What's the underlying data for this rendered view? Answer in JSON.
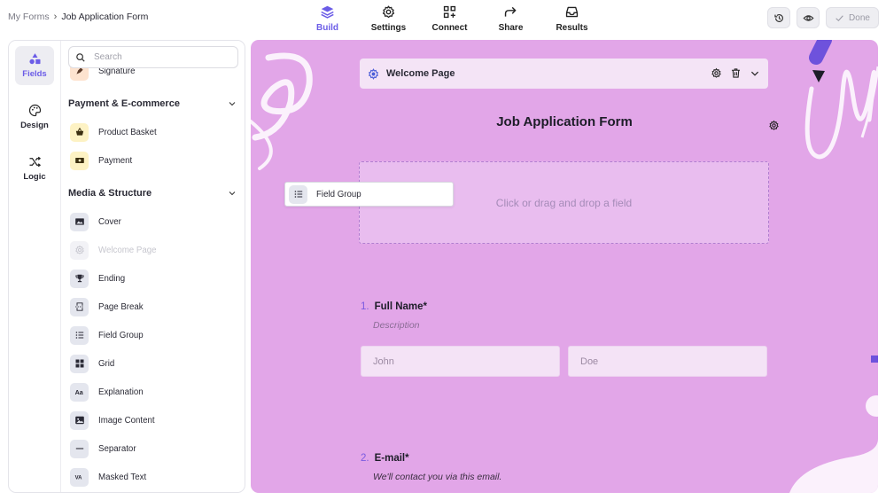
{
  "breadcrumb": {
    "root": "My Forms",
    "separator": "›",
    "current": "Job Application Form"
  },
  "nav": {
    "tabs": [
      {
        "label": "Build",
        "icon": "layers-icon",
        "active": true
      },
      {
        "label": "Settings",
        "icon": "gear-icon",
        "active": false
      },
      {
        "label": "Connect",
        "icon": "connect-grid-icon",
        "active": false
      },
      {
        "label": "Share",
        "icon": "share-arrow-icon",
        "active": false
      },
      {
        "label": "Results",
        "icon": "inbox-icon",
        "active": false
      }
    ]
  },
  "toolbar": {
    "done_label": "Done"
  },
  "rail": {
    "items": [
      {
        "label": "Fields",
        "icon": "shapes-icon",
        "active": true
      },
      {
        "label": "Design",
        "icon": "palette-icon",
        "active": false
      },
      {
        "label": "Logic",
        "icon": "shuffle-icon",
        "active": false
      }
    ]
  },
  "search": {
    "placeholder": "Search"
  },
  "fields": {
    "partial_item": "Signature",
    "sections": [
      {
        "title": "Payment & E-commerce",
        "items": [
          "Product Basket",
          "Payment"
        ]
      },
      {
        "title": "Media & Structure",
        "items": [
          "Cover",
          "Welcome Page",
          "Ending",
          "Page Break",
          "Field Group",
          "Grid",
          "Explanation",
          "Image Content",
          "Separator",
          "Masked Text"
        ]
      }
    ],
    "disabled": [
      "Welcome Page"
    ]
  },
  "canvas": {
    "welcome_bar_title": "Welcome Page",
    "form_title": "Job Application Form",
    "dropzone_text": "Click or drag and drop a field",
    "drag_ghost_label": "Field Group",
    "questions": [
      {
        "number": "1.",
        "label": "Full Name*",
        "description": "Description",
        "inputs": [
          "John",
          "Doe"
        ]
      },
      {
        "number": "2.",
        "label": "E-mail*",
        "description": "We'll contact you via this email."
      }
    ]
  },
  "colors": {
    "accent": "#6b5ce7",
    "canvas_bg": "#e2a6e8",
    "dropzone_bg": "#e9bdef"
  }
}
